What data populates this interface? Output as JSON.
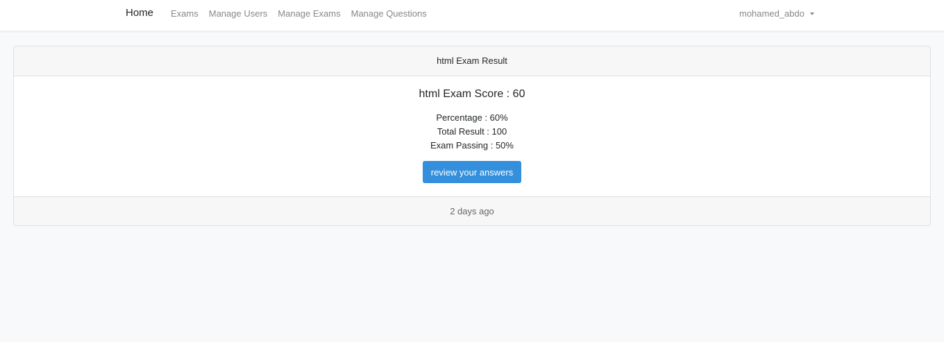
{
  "nav": {
    "brand": "Home",
    "links": [
      "Exams",
      "Manage Users",
      "Manage Exams",
      "Manage Questions"
    ],
    "user": "mohamed_abdo",
    "user_caret_icon": "caret-down-icon"
  },
  "card": {
    "header": "html Exam Result",
    "score_title": "html Exam Score : 60",
    "percentage": "Percentage : 60%",
    "total_result": "Total Result : 100",
    "exam_passing": "Exam Passing : 50%",
    "review_button": "review your answers",
    "footer": "2 days ago"
  },
  "colors": {
    "primary_button": "#3490dc",
    "background": "#f8f9fa"
  }
}
